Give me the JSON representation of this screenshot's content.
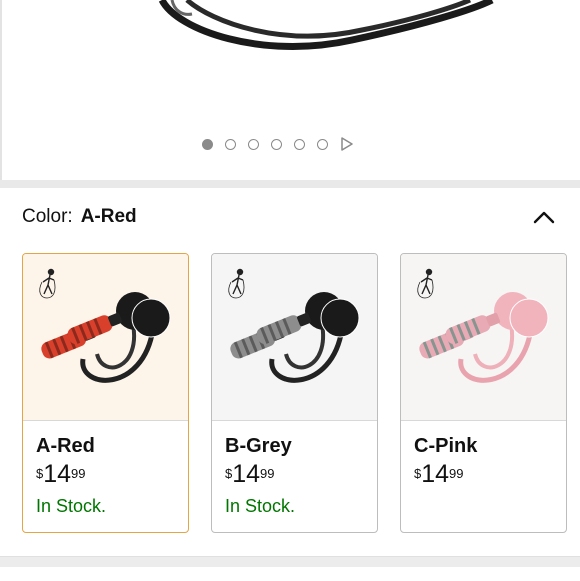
{
  "carousel": {
    "slide_count": 6,
    "active_index": 0
  },
  "variation": {
    "label": "Color:",
    "selected_value": "A-Red",
    "options": [
      {
        "name": "A-Red",
        "currency": "$",
        "whole": "14",
        "fraction": "99",
        "stock": "In Stock.",
        "ball_color": "#1a1a1a",
        "grip_color": "#d9402b"
      },
      {
        "name": "B-Grey",
        "currency": "$",
        "whole": "14",
        "fraction": "99",
        "stock": "In Stock.",
        "ball_color": "#1a1a1a",
        "grip_color": "#8d8d8d"
      },
      {
        "name": "C-Pink",
        "currency": "$",
        "whole": "14",
        "fraction": "99",
        "stock": "",
        "ball_color": "#f1b4bd",
        "grip_color": "#e8aab4"
      }
    ]
  },
  "colors": {
    "selected_border": "#e4a546",
    "in_stock": "#007600"
  }
}
